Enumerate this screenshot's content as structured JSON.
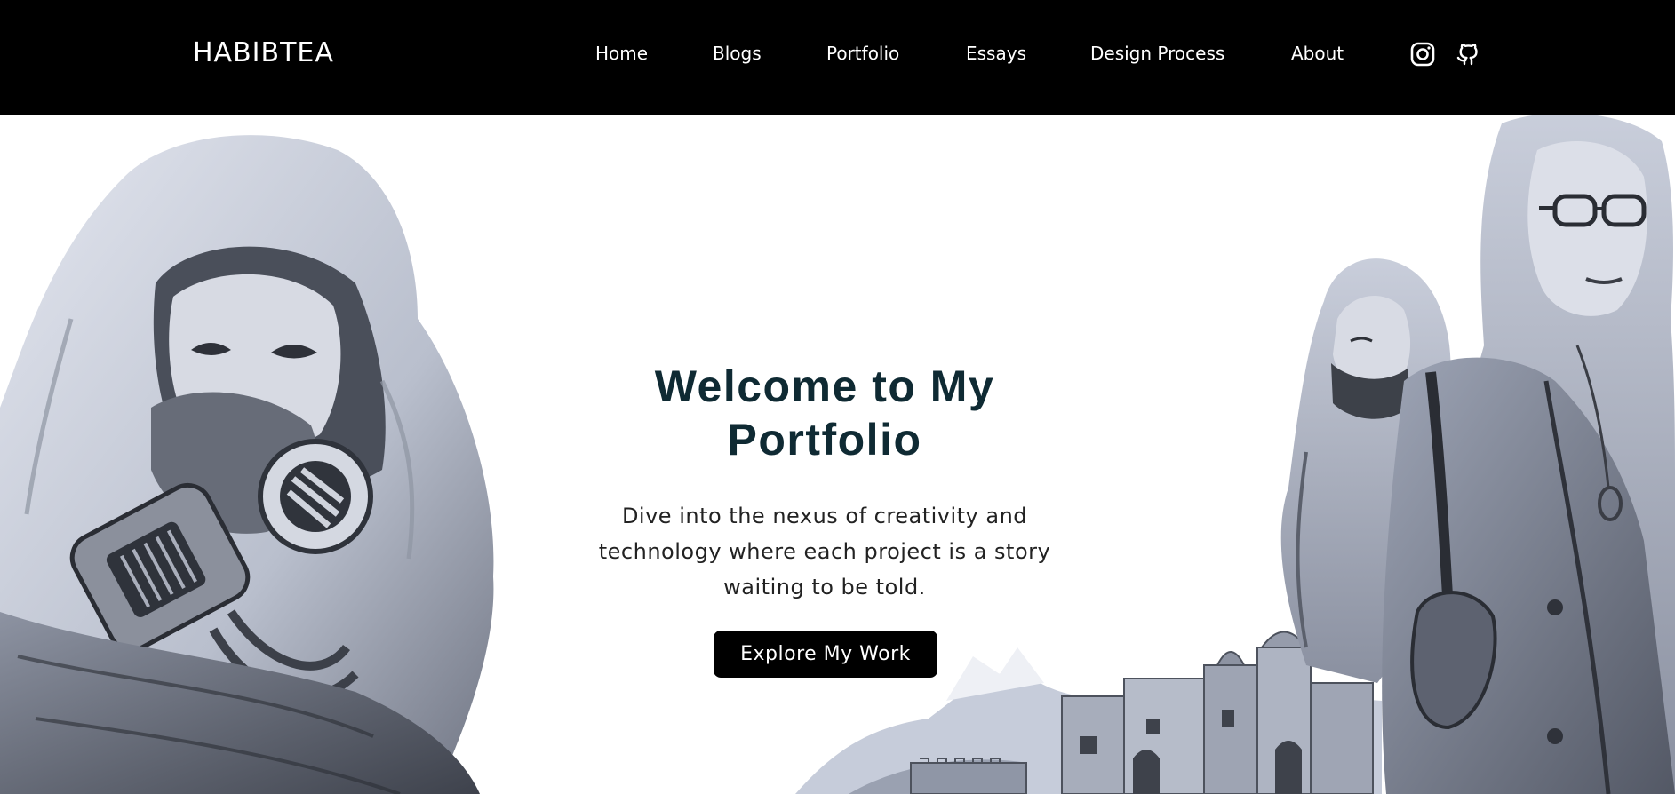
{
  "header": {
    "brand": "HABIBTEA",
    "nav": [
      "Home",
      "Blogs",
      "Portfolio",
      "Essays",
      "Design Process",
      "About"
    ],
    "icons": [
      "instagram-icon",
      "github-icon"
    ]
  },
  "hero": {
    "title_line1": "Welcome to My",
    "title_line2": "Portfolio",
    "subtitle_line1": "Dive into the nexus of creativity and",
    "subtitle_line2": "technology where each project is a story",
    "subtitle_line3": "waiting to be told.",
    "cta_label": "Explore My Work"
  },
  "colors": {
    "nav_bg": "#000000",
    "title": "#0f2a33",
    "button_bg": "#000000",
    "sketch_tint": "#c9cfdd"
  }
}
